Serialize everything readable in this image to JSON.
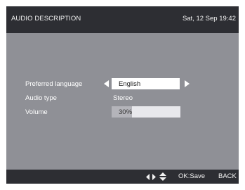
{
  "header": {
    "title": "AUDIO DESCRIPTION",
    "datetime": "Sat, 12 Sep 19:42"
  },
  "settings": {
    "preferred_language": {
      "label": "Preferred language",
      "value": "English"
    },
    "audio_type": {
      "label": "Audio type",
      "value": "Stereo"
    },
    "volume": {
      "label": "Volume",
      "value_text": "30%",
      "level": 0.3
    }
  },
  "footer": {
    "nav_icons": [
      "left-right-arrows-icon",
      "up-down-arrows-icon"
    ],
    "ok_hint": "OK:Save",
    "back_hint": "BACK"
  },
  "colors": {
    "bar_background": "#2d2e33",
    "panel_background": "#8f9096",
    "selection": "#ffffff"
  }
}
